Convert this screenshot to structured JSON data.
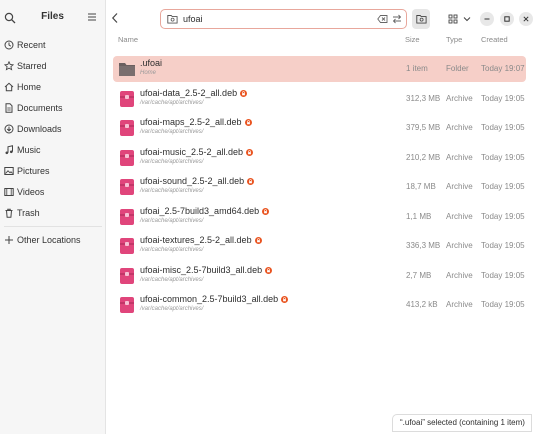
{
  "sidebar": {
    "title": "Files",
    "items": [
      {
        "label": "Recent",
        "icon": "clock-icon"
      },
      {
        "label": "Starred",
        "icon": "star-icon"
      },
      {
        "label": "Home",
        "icon": "home-icon"
      },
      {
        "label": "Documents",
        "icon": "document-icon"
      },
      {
        "label": "Downloads",
        "icon": "download-icon"
      },
      {
        "label": "Music",
        "icon": "music-icon"
      },
      {
        "label": "Pictures",
        "icon": "picture-icon"
      },
      {
        "label": "Videos",
        "icon": "video-icon"
      },
      {
        "label": "Trash",
        "icon": "trash-icon"
      }
    ],
    "other_locations": "Other Locations"
  },
  "location": {
    "value": "ufoai"
  },
  "columns": {
    "name": "Name",
    "size": "Size",
    "type": "Type",
    "created": "Created"
  },
  "files": [
    {
      "name": ".ufoai",
      "path": "Home",
      "size": "1 item",
      "type": "Folder",
      "created": "Today 19:07",
      "kind": "folder",
      "locked": false
    },
    {
      "name": "ufoai-data_2.5-2_all.deb",
      "path": "/var/cache/apt/archives/",
      "size": "312,3 MB",
      "type": "Archive",
      "created": "Today 19:05",
      "kind": "archive",
      "locked": true
    },
    {
      "name": "ufoai-maps_2.5-2_all.deb",
      "path": "/var/cache/apt/archives/",
      "size": "379,5 MB",
      "type": "Archive",
      "created": "Today 19:05",
      "kind": "archive",
      "locked": true
    },
    {
      "name": "ufoai-music_2.5-2_all.deb",
      "path": "/var/cache/apt/archives/",
      "size": "210,2 MB",
      "type": "Archive",
      "created": "Today 19:05",
      "kind": "archive",
      "locked": true
    },
    {
      "name": "ufoai-sound_2.5-2_all.deb",
      "path": "/var/cache/apt/archives/",
      "size": "18,7 MB",
      "type": "Archive",
      "created": "Today 19:05",
      "kind": "archive",
      "locked": true
    },
    {
      "name": "ufoai_2.5-7build3_amd64.deb",
      "path": "/var/cache/apt/archives/",
      "size": "1,1 MB",
      "type": "Archive",
      "created": "Today 19:05",
      "kind": "archive",
      "locked": true
    },
    {
      "name": "ufoai-textures_2.5-2_all.deb",
      "path": "/var/cache/apt/archives/",
      "size": "336,3 MB",
      "type": "Archive",
      "created": "Today 19:05",
      "kind": "archive",
      "locked": true
    },
    {
      "name": "ufoai-misc_2.5-7build3_all.deb",
      "path": "/var/cache/apt/archives/",
      "size": "2,7 MB",
      "type": "Archive",
      "created": "Today 19:05",
      "kind": "archive",
      "locked": true
    },
    {
      "name": "ufoai-common_2.5-7build3_all.deb",
      "path": "/var/cache/apt/archives/",
      "size": "413,2 kB",
      "type": "Archive",
      "created": "Today 19:05",
      "kind": "archive",
      "locked": true
    }
  ],
  "status": "“.ufoai” selected  (containing 1 item)",
  "colors": {
    "accent": "#e95420",
    "selection": "#f6cfc8",
    "archive": "#e0457b",
    "folder": "#6b5f5f"
  }
}
